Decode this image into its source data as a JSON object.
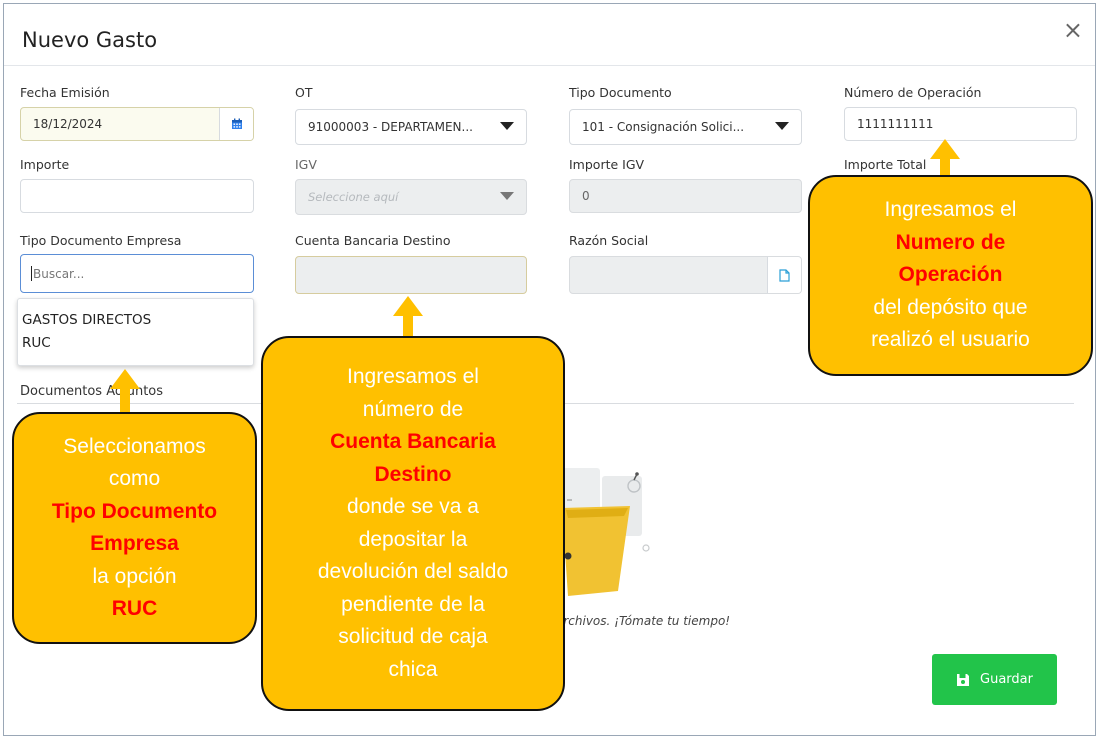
{
  "modal": {
    "title": "Nuevo Gasto",
    "close": "×"
  },
  "fields": {
    "fecha_emision": {
      "label": "Fecha Emisión",
      "value": "18/12/2024"
    },
    "ot": {
      "label": "OT",
      "value": "91000003 - DEPARTAMEN..."
    },
    "tipo_documento": {
      "label": "Tipo Documento",
      "value": "101 - Consignación Solici..."
    },
    "numero_operacion": {
      "label": "Número de Operación",
      "value": "1111111111"
    },
    "importe": {
      "label": "Importe",
      "value": ""
    },
    "igv": {
      "label": "IGV",
      "placeholder": "Seleccione aquí"
    },
    "importe_igv": {
      "label": "Importe IGV",
      "value": "0"
    },
    "importe_total": {
      "label": "Importe Total"
    },
    "tipo_doc_empresa": {
      "label": "Tipo Documento Empresa",
      "placeholder": "Buscar..."
    },
    "cuenta_bancaria": {
      "label": "Cuenta Bancaria Destino",
      "value": ""
    },
    "razon_social": {
      "label": "Razón Social",
      "value": ""
    }
  },
  "dropdown": {
    "options": [
      "GASTOS DIRECTOS",
      "RUC"
    ]
  },
  "documentos": {
    "label": "Documentos Adjuntos"
  },
  "hint": "archivos. ¡Tómate tu tiempo!",
  "save_button": {
    "label": "Guardar"
  },
  "callouts": {
    "left": {
      "l1": "Seleccionamos",
      "l2": "como",
      "h1": "Tipo Documento",
      "h2": "Empresa",
      "l3": "la opción",
      "h3": "RUC"
    },
    "middle": {
      "l1": "Ingresamos el",
      "l2": "número de",
      "h1": "Cuenta Bancaria",
      "h2": "Destino",
      "l3": "donde se va a",
      "l4": "depositar la",
      "l5": "devolución del saldo",
      "l6": "pendiente de la",
      "l7": "solicitud de caja",
      "l8": "chica"
    },
    "right": {
      "l1": "Ingresamos el",
      "h1": "Numero de",
      "h2": "Operación",
      "l2": "del depósito que",
      "l3": "realizó el usuario"
    }
  },
  "colors": {
    "callout": "#ffc000",
    "highlight": "#ff0000",
    "save": "#22c44a",
    "accent": "#2f80ed"
  }
}
